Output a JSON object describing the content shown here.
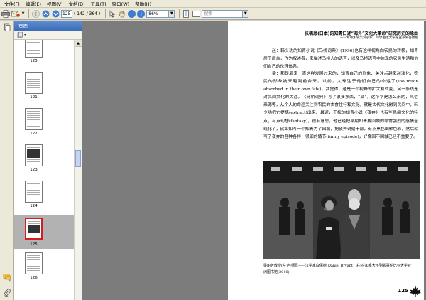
{
  "menubar": [
    "文件(F)",
    "编辑(E)",
    "视图(V)",
    "文档(D)",
    "工具(T)",
    "窗口(W)",
    "帮助(H)"
  ],
  "toolbar": {
    "current_page": "125",
    "page_total": "( 142 / 364 )",
    "zoom": "86%",
    "search_placeholder": "搜索"
  },
  "sidebar": {
    "title": "页面",
    "thumbnails": [
      {
        "label": "125",
        "selected": false
      },
      {
        "label": "121",
        "selected": false
      },
      {
        "label": "122",
        "selected": false
      },
      {
        "label": "123",
        "selected": false
      },
      {
        "label": "124",
        "selected": false
      },
      {
        "label": "125",
        "selected": true
      },
      {
        "label": "126",
        "selected": false
      }
    ]
  },
  "document": {
    "running_head": "张楠恩(日本)的知青口述“海外”文化大革命”研究历史的缘由",
    "running_subhead": "——专访加拿大汉学家、阿尔伯达大学东亚系荣誉教授",
    "paragraph1": "赵：韩少功的知青小说《马桥词典》(1996)也有这样视角向农民的转移，知青居于后台，作为叙述者，来描述马桥人的语言，以及马桥语言中体现的农民生活和他们自己的伦理体系。",
    "paragraph2": "梁：那是后来一直这样发展过来的，知青自己的形象、关注点越来越淡化，农民的形象被来越到前台来。以前，太专注于他们自己的命运了(too much absorbed in their own fate)。我觉得，这是一个视野的扩大和转变，另一条线是对民间文化的关注。《马桥词典》写了很多东西，“枭”，这个字是怎么来的，风俗来源等，从个人的命运关注到农民的衣食住行和文化，就是古代文化融到民间中，韩少功把它提炼(extract)出来。最近，王松的知青小说《夜奔》也有些民间文化的特点，有点幻想(fantasy)，很有意思，他已经把早期知青要回城的非常强烈的感情全线化了，比如知写一个知青为了回城，把夜奔说给干部，有点黑色幽默色彩，然后就写了夜奔的各种各样，很细的情节(funny episode)，好像回不回城已经不重要了。",
    "caption": "梁丽芳教授(左)与师兄——汉学家白保德(Daniel Bryant，右)在加拿大不列颠哥伦比亚大学亚洲图书馆(2010)",
    "page_number": "125"
  }
}
